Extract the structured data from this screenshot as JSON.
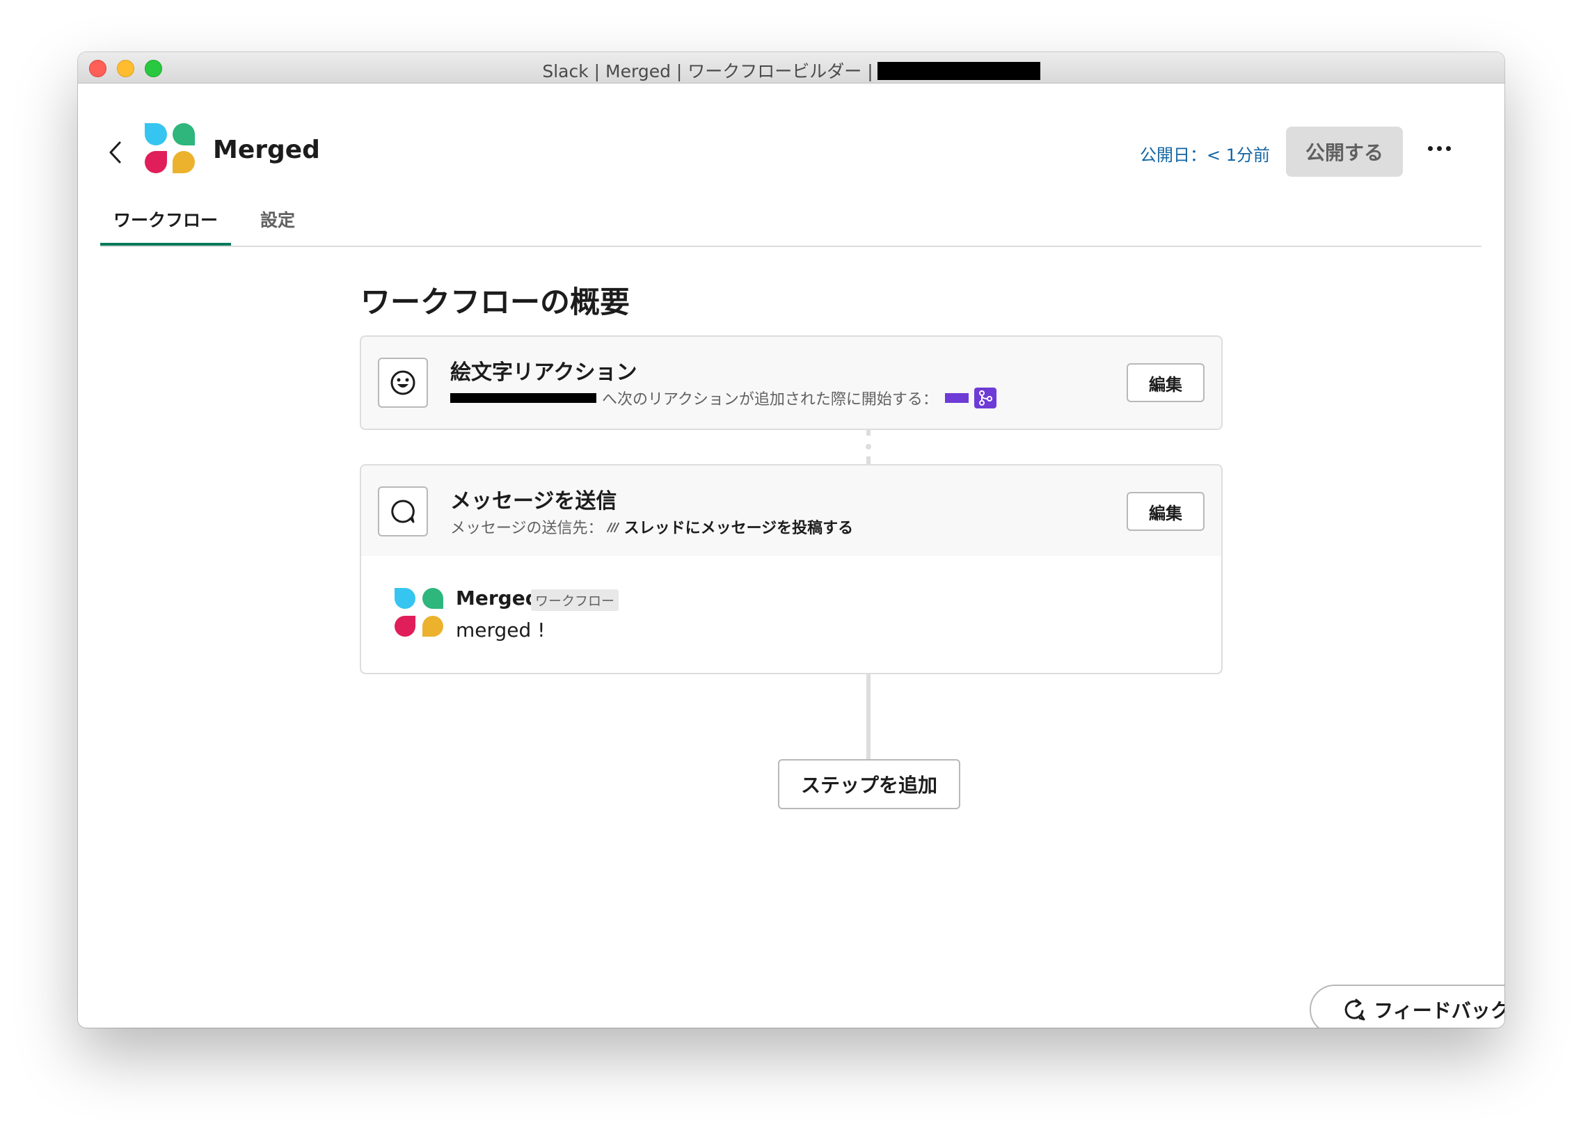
{
  "window": {
    "title": "Slack | Merged | ワークフロービルダー |"
  },
  "header": {
    "workflow_name": "Merged",
    "published_label": "公開日：< 1分前",
    "publish_button": "公開する"
  },
  "tabs": [
    {
      "label": "ワークフロー",
      "active": true
    },
    {
      "label": "設定",
      "active": false
    }
  ],
  "main": {
    "title": "ワークフローの概要",
    "steps": [
      {
        "title": "絵文字リアクション",
        "description": "へ次のリアクションが追加された際に開始する：",
        "edit_label": "編集",
        "icon": "emoji-icon"
      },
      {
        "title": "メッセージを送信",
        "description_prefix": "メッセージの送信先：",
        "description_target": "スレッドにメッセージを投稿する",
        "edit_label": "編集",
        "icon": "message-bubble-icon",
        "preview": {
          "sender": "Merged",
          "tag": "ワークフロー",
          "text": "merged !"
        }
      }
    ],
    "add_step_button": "ステップを追加"
  },
  "feedback_button": "フィードバック",
  "colors": {
    "accent_tab": "#007a5a",
    "link_blue": "#1264a3",
    "emoji_purple": "#6e3bd6",
    "logo_blue": "#36c5f0",
    "logo_green": "#2eb67d",
    "logo_red": "#e01e5a",
    "logo_yellow": "#ecb22e"
  }
}
